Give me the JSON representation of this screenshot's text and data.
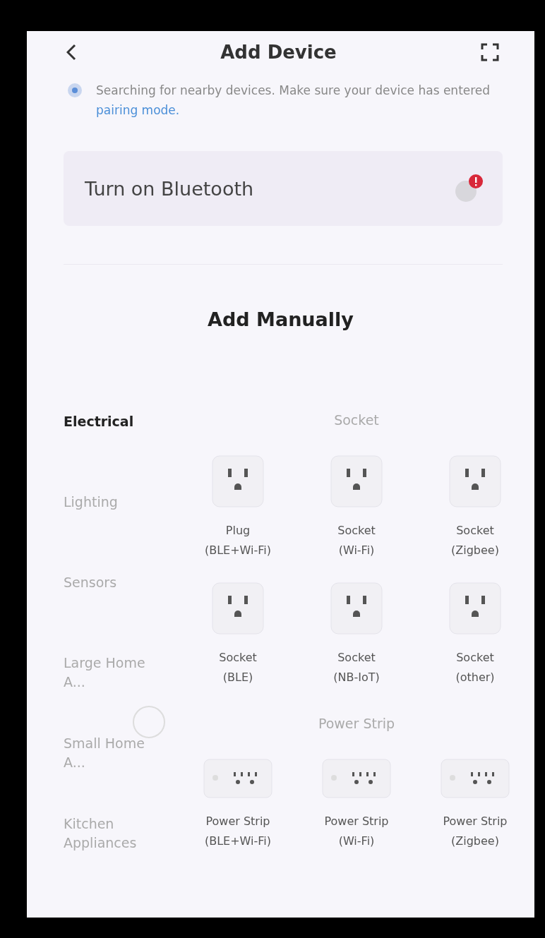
{
  "header": {
    "title": "Add Device"
  },
  "search_notice": {
    "text": "Searching for nearby devices. Make sure your device has entered",
    "link": "pairing mode."
  },
  "bluetooth_card": {
    "label": "Turn on Bluetooth",
    "alert": true
  },
  "section_title": "Add Manually",
  "sidebar": {
    "items": [
      {
        "label": "Electrical",
        "selected": true
      },
      {
        "label": "Lighting",
        "selected": false
      },
      {
        "label": "Sensors",
        "selected": false
      },
      {
        "label": "Large Home A...",
        "selected": false
      },
      {
        "label": "Small Home A...",
        "selected": false
      },
      {
        "label": "Kitchen Appliances",
        "selected": false
      }
    ]
  },
  "groups": [
    {
      "title": "Socket",
      "devices": [
        {
          "kind": "socket",
          "name": "Plug",
          "variant": "(BLE+Wi-Fi)"
        },
        {
          "kind": "socket",
          "name": "Socket",
          "variant": "(Wi-Fi)"
        },
        {
          "kind": "socket",
          "name": "Socket",
          "variant": "(Zigbee)"
        },
        {
          "kind": "socket",
          "name": "Socket",
          "variant": "(BLE)"
        },
        {
          "kind": "socket",
          "name": "Socket",
          "variant": "(NB-IoT)"
        },
        {
          "kind": "socket",
          "name": "Socket",
          "variant": "(other)"
        }
      ]
    },
    {
      "title": "Power Strip",
      "devices": [
        {
          "kind": "strip",
          "name": "Power Strip",
          "variant": "(BLE+Wi-Fi)"
        },
        {
          "kind": "strip",
          "name": "Power Strip",
          "variant": "(Wi-Fi)"
        },
        {
          "kind": "strip",
          "name": "Power Strip",
          "variant": "(Zigbee)"
        }
      ]
    }
  ],
  "loading": true
}
